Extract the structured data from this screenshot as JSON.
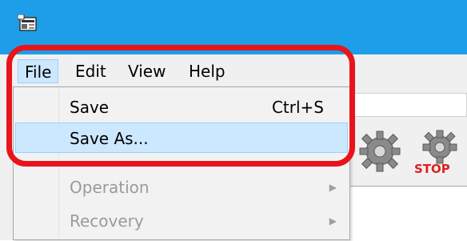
{
  "window": {
    "app_icon": "application-icon"
  },
  "menubar": {
    "items": [
      {
        "label": "File",
        "active": true
      },
      {
        "label": "Edit"
      },
      {
        "label": "View"
      },
      {
        "label": "Help"
      }
    ]
  },
  "file_menu": {
    "items": [
      {
        "label": "Save",
        "shortcut": "Ctrl+S",
        "enabled": true
      },
      {
        "label": "Save As...",
        "enabled": true,
        "hovered": true
      },
      {
        "label": "Operation",
        "submenu": true,
        "enabled": false
      },
      {
        "label": "Recovery",
        "submenu": true,
        "enabled": false
      }
    ]
  },
  "toolbar": {
    "start_icon": "gear-icon",
    "stop_icon": "gear-stop-icon",
    "stop_label": "STOP"
  },
  "highlight": {
    "color": "#e8141c"
  },
  "colors": {
    "titlebar": "#1e9ee8",
    "menu_hover": "#cce8ff",
    "menu_hover_border": "#99d1ff",
    "disabled_text": "#9a9a9a",
    "stop_red": "#e02020"
  }
}
